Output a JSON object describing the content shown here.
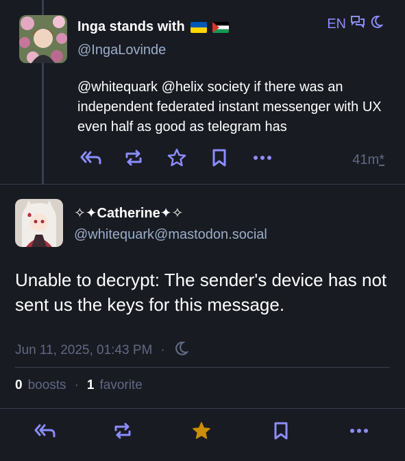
{
  "post1": {
    "display_name": "Inga stands with",
    "flags": [
      "ukraine-flag",
      "palestine-flag"
    ],
    "handle": "@IngaLovinde",
    "language": "EN",
    "content": "@whitequark @helix society if there was an independent federated instant messenger with UX even half as good as telegram has",
    "relative_time": "41m",
    "edited_mark": "*"
  },
  "post2": {
    "display_name": "✧✦Catherine✦✧",
    "handle": "@whitequark@mastodon.social",
    "content": "Unable to decrypt: The sender's device has not sent us the keys for this message.",
    "date": "Jun 11, 2025, 01:43 PM",
    "separator": "·",
    "boosts_count": "0",
    "boosts_label": "boosts",
    "favorites_count": "1",
    "favorites_label": "favorite",
    "favorited": true
  },
  "colors": {
    "background": "#191b22",
    "divider": "#393f4f",
    "handle": "#9baec8",
    "muted": "#606984",
    "accent": "#8c8dff",
    "favorite": "#ca8f04"
  }
}
